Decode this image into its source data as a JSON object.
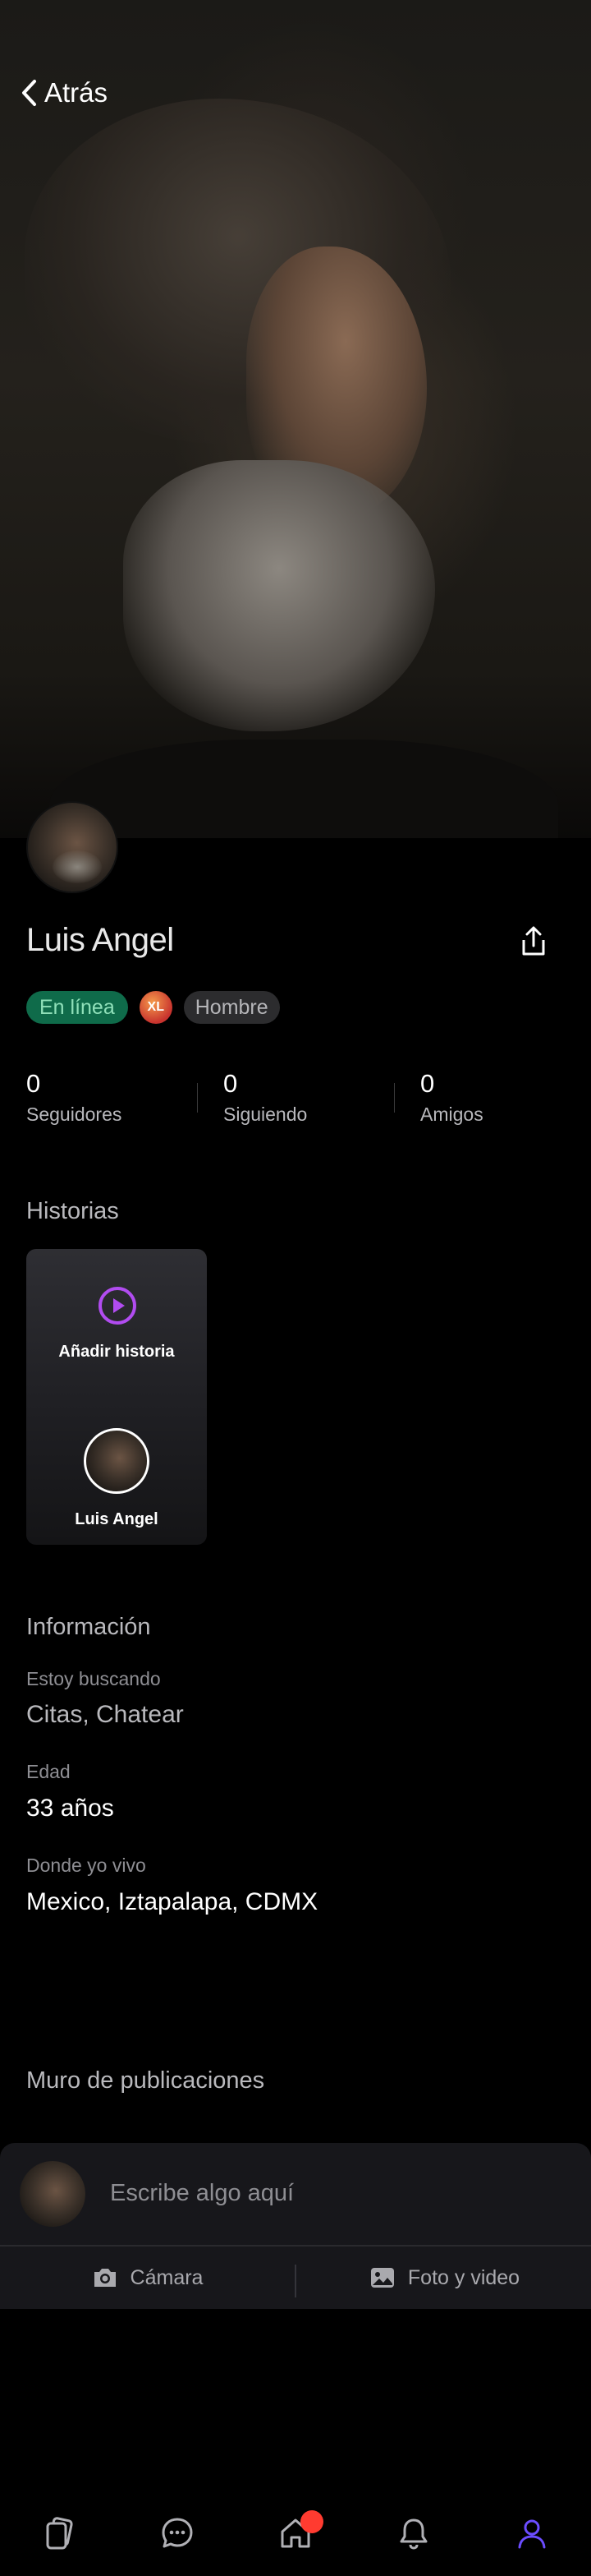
{
  "header": {
    "back_label": "Atrás"
  },
  "profile": {
    "name": "Luis Angel",
    "badges": {
      "status": "En línea",
      "size": "XL",
      "gender": "Hombre"
    },
    "stats": [
      {
        "value": "0",
        "label": "Seguidores"
      },
      {
        "value": "0",
        "label": "Siguiendo"
      },
      {
        "value": "0",
        "label": "Amigos"
      }
    ]
  },
  "stories": {
    "title": "Historias",
    "add_label": "Añadir historia",
    "owner_name": "Luis Angel"
  },
  "info": {
    "title": "Información",
    "looking_for_label": "Estoy buscando",
    "looking_for_value": "Citas, Chatear",
    "age_label": "Edad",
    "age_value": "33 años",
    "location_label": "Donde yo vivo",
    "location_value": "Mexico, Iztapalapa, CDMX"
  },
  "wall": {
    "title": "Muro de publicaciones",
    "placeholder": "Escribe algo aquí",
    "camera_label": "Cámara",
    "media_label": "Foto y video"
  },
  "nav": {
    "items": [
      "feed-icon",
      "chat-icon",
      "home-icon",
      "bell-icon",
      "profile-icon"
    ],
    "active": "profile-icon",
    "accent_color": "#6b4cff",
    "notification_color": "#ff3b30"
  },
  "colors": {
    "online": "#0f6b4a",
    "story_icon": "#b14cf0"
  }
}
